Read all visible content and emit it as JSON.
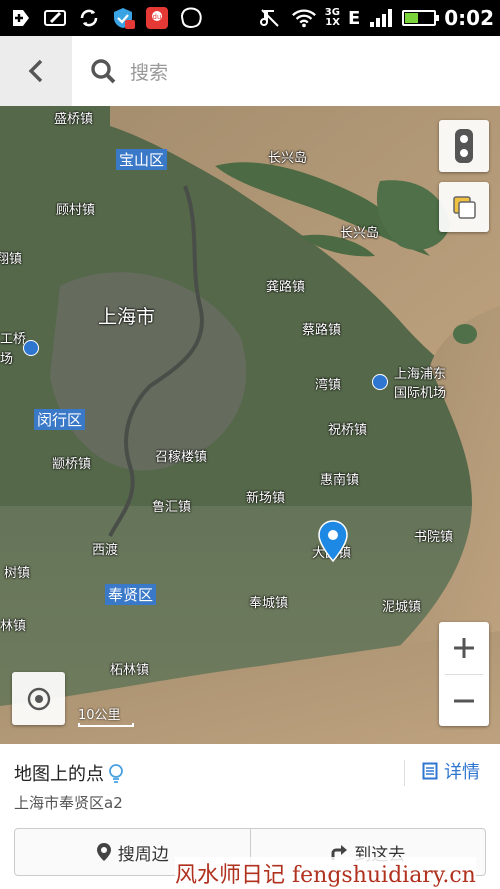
{
  "status_bar": {
    "network_top": "3G",
    "network_bottom": "1X",
    "network_type": "E",
    "time": "0:02",
    "battery_level": 0.45,
    "icons": [
      "add-icon",
      "edit-icon",
      "sync-icon",
      "shield-icon",
      "du-app-icon",
      "blob-icon",
      "music-off-icon",
      "wifi-icon",
      "signal-icon",
      "battery-icon"
    ]
  },
  "search": {
    "placeholder": "搜索"
  },
  "map": {
    "labels": {
      "l1": "盛桥镇",
      "l2": "宝山区",
      "l3": "长兴岛",
      "l4": "顾村镇",
      "l5": "长兴岛",
      "l6": "翔镇",
      "l7": "龚路镇",
      "l8": "上海市",
      "l9": "蔡路镇",
      "l10": "工桥",
      "l11": "场",
      "l12": "上海浦东",
      "l13": "国际机场",
      "l14": "湾镇",
      "l15": "闵行区",
      "l16": "祝桥镇",
      "l17": "颛桥镇",
      "l18": "召稼楼镇",
      "l19": "惠南镇",
      "l20": "鲁汇镇",
      "l21": "新场镇",
      "l22": "西渡",
      "l23": "大团镇",
      "l24": "书院镇",
      "l25": "树镇",
      "l26": "奉贤区",
      "l27": "奉城镇",
      "l28": "泥城镇",
      "l29": "林镇",
      "l30": "柘林镇"
    },
    "scale_label": "10公里",
    "marker": "location-pin"
  },
  "panel": {
    "place_name": "地图上的点",
    "address": "上海市奉贤区a2",
    "detail_label": "详情",
    "nearby_label": "搜周边",
    "goto_label": "到这去"
  },
  "watermark": "风水师日记 fengshuidiary.cn",
  "colors": {
    "accent": "#2f76d0",
    "marker": "#1e88e5",
    "water": "#b49b78",
    "land": "#5d6e4e",
    "watermark": "#b0311e"
  }
}
